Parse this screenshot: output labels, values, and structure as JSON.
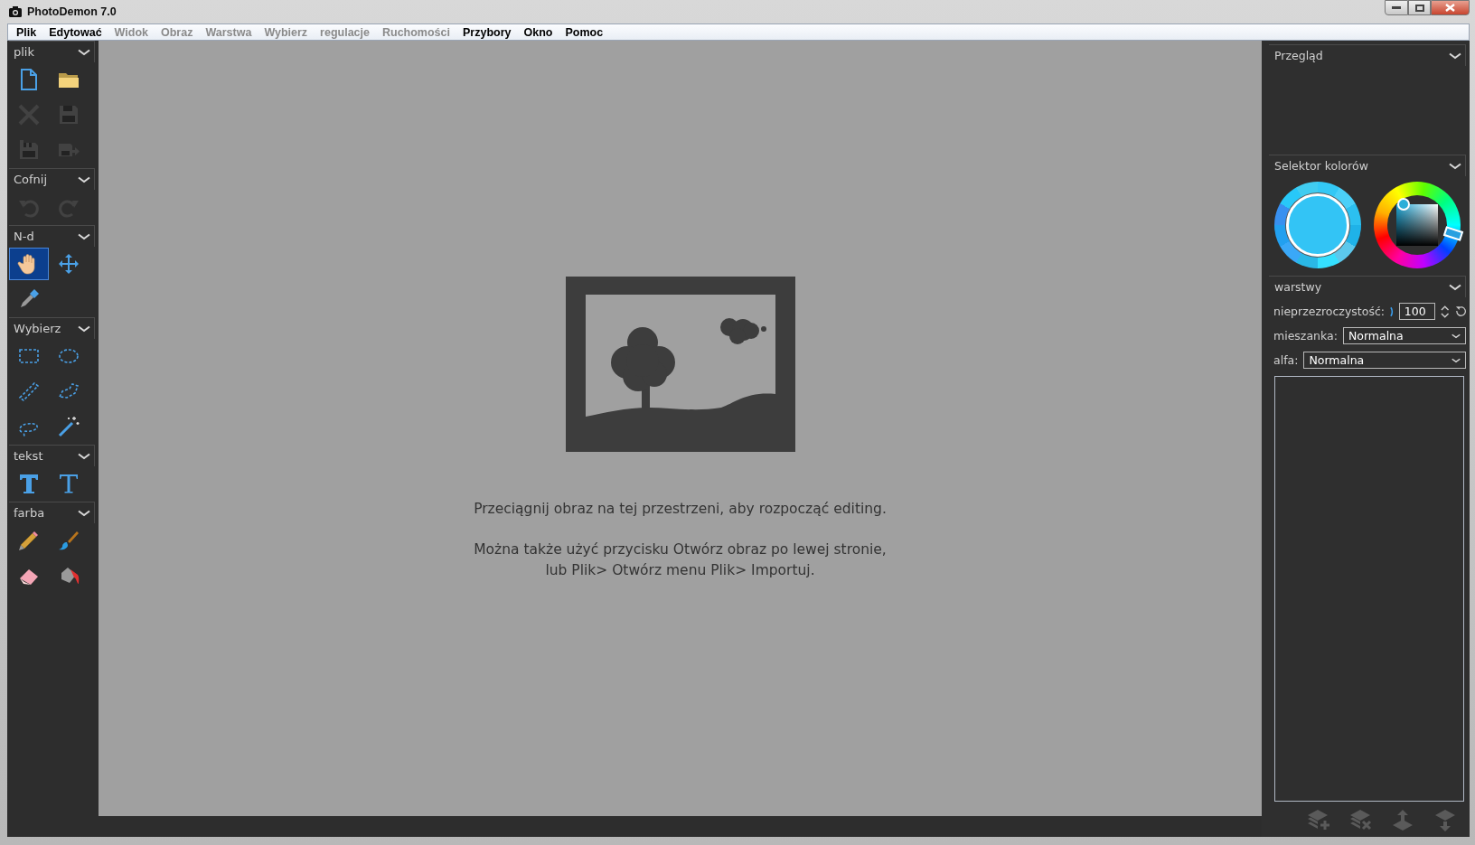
{
  "window": {
    "title": "PhotoDemon 7.0"
  },
  "menu": [
    {
      "label": "Plik",
      "disabled": false
    },
    {
      "label": "Edytować",
      "disabled": false
    },
    {
      "label": "Widok",
      "disabled": true
    },
    {
      "label": "Obraz",
      "disabled": true
    },
    {
      "label": "Warstwa",
      "disabled": true
    },
    {
      "label": "Wybierz",
      "disabled": true
    },
    {
      "label": "regulacje",
      "disabled": true
    },
    {
      "label": "Ruchomości",
      "disabled": true
    },
    {
      "label": "Przybory",
      "disabled": false
    },
    {
      "label": "Okno",
      "disabled": false
    },
    {
      "label": "Pomoc",
      "disabled": false
    }
  ],
  "toolbox": [
    {
      "title": "plik",
      "tools": [
        {
          "kind": "new",
          "disabled": false,
          "selected": false
        },
        {
          "kind": "open",
          "disabled": false,
          "selected": false
        },
        {
          "kind": "close",
          "disabled": true,
          "selected": false
        },
        {
          "kind": "save",
          "disabled": true,
          "selected": false
        },
        {
          "kind": "save-as",
          "disabled": true,
          "selected": false
        },
        {
          "kind": "export",
          "disabled": true,
          "selected": false
        }
      ]
    },
    {
      "title": "Cofnij",
      "tools": [
        {
          "kind": "undo",
          "disabled": true,
          "selected": false
        },
        {
          "kind": "redo",
          "disabled": true,
          "selected": false
        }
      ]
    },
    {
      "title": "N-d",
      "tools": [
        {
          "kind": "hand",
          "disabled": false,
          "selected": true
        },
        {
          "kind": "move",
          "disabled": false,
          "selected": false
        },
        {
          "kind": "eyedropper",
          "disabled": false,
          "selected": false
        }
      ]
    },
    {
      "title": "Wybierz",
      "tools": [
        {
          "kind": "rect-select",
          "disabled": false,
          "selected": false
        },
        {
          "kind": "ellipse-select",
          "disabled": false,
          "selected": false
        },
        {
          "kind": "line-select",
          "disabled": false,
          "selected": false
        },
        {
          "kind": "polygon-select",
          "disabled": false,
          "selected": false
        },
        {
          "kind": "lasso-select",
          "disabled": false,
          "selected": false
        },
        {
          "kind": "wand",
          "disabled": false,
          "selected": false
        }
      ]
    },
    {
      "title": "tekst",
      "tools": [
        {
          "kind": "text-basic",
          "disabled": false,
          "selected": false
        },
        {
          "kind": "text-fancy",
          "disabled": false,
          "selected": false
        }
      ]
    },
    {
      "title": "farba",
      "tools": [
        {
          "kind": "pencil",
          "disabled": false,
          "selected": false
        },
        {
          "kind": "brush",
          "disabled": false,
          "selected": false
        },
        {
          "kind": "eraser",
          "disabled": false,
          "selected": false
        },
        {
          "kind": "fill",
          "disabled": false,
          "selected": false
        }
      ]
    }
  ],
  "canvas": {
    "hint": "Przeciągnij obraz na tej przestrzeni, aby rozpocząć editing.",
    "help_lines": [
      "Można także użyć przycisku Otwórz obraz po lewej stronie,",
      "lub Plik> Otwórz menu Plik> Importuj."
    ]
  },
  "right_panel": {
    "overview": {
      "title": "Przegląd"
    },
    "color_selector": {
      "title": "Selektor kolorów"
    },
    "layers": {
      "title": "warstwy",
      "opacity_label": "nieprzezroczystość:",
      "opacity_value": "100",
      "blend_label": "mieszanka:",
      "blend_value": "Normalna",
      "alpha_label": "alfa:",
      "alpha_value": "Normalna",
      "buttons": [
        {
          "kind": "add",
          "disabled": true
        },
        {
          "kind": "delete",
          "disabled": true
        },
        {
          "kind": "up",
          "disabled": true
        },
        {
          "kind": "down",
          "disabled": true
        }
      ]
    }
  }
}
